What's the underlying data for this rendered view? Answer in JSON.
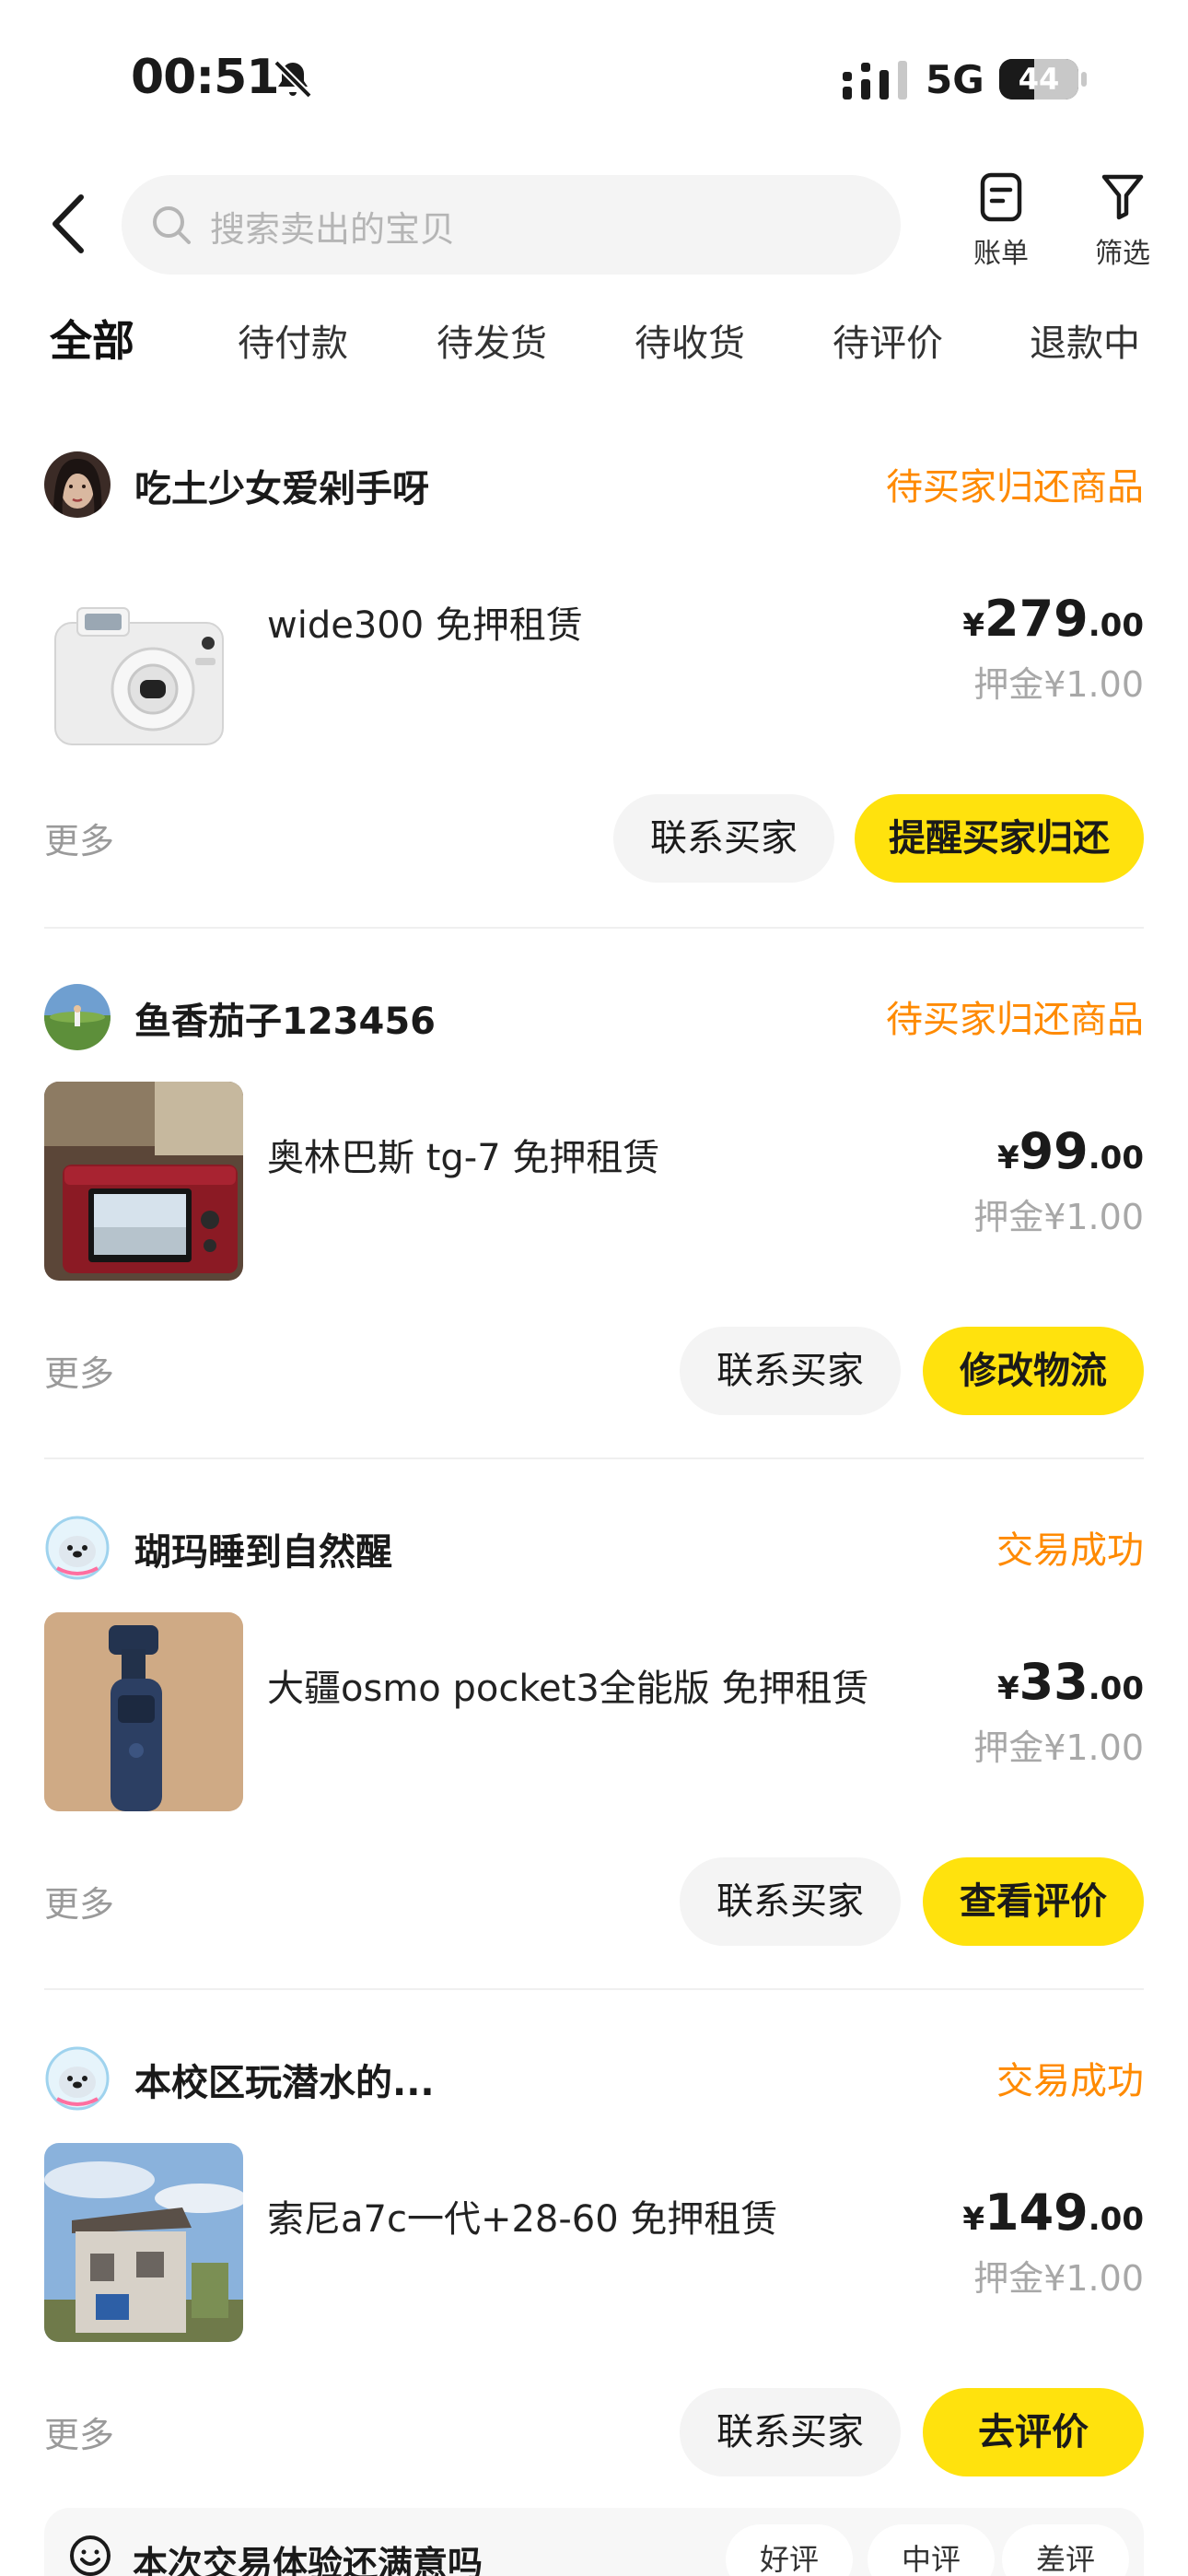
{
  "status_bar": {
    "time": "00:51",
    "network": "5G",
    "battery": "44",
    "battery_level": 0.44
  },
  "search": {
    "placeholder": "搜索卖出的宝贝"
  },
  "actions": {
    "bill": "账单",
    "filter": "筛选"
  },
  "tabs": [
    "全部",
    "待付款",
    "待发货",
    "待收货",
    "待评价",
    "退款中"
  ],
  "orders": [
    {
      "buyer": "吃土少女爱剁手呀",
      "status": "待买家归还商品",
      "title": "wide300 免押租赁",
      "currency": "¥",
      "price_int": "279",
      "price_dec": ".00",
      "deposit": "押金¥1.00",
      "more": "更多",
      "btn1": "联系买家",
      "btn2": "提醒买家归还"
    },
    {
      "buyer": "鱼香茄子123456",
      "status": "待买家归还商品",
      "title": "奥林巴斯 tg-7 免押租赁",
      "currency": "¥",
      "price_int": "99",
      "price_dec": ".00",
      "deposit": "押金¥1.00",
      "more": "更多",
      "btn1": "联系买家",
      "btn2": "修改物流"
    },
    {
      "buyer": "瑚玛睡到自然醒",
      "status": "交易成功",
      "title": "大疆osmo pocket3全能版 免押租赁",
      "currency": "¥",
      "price_int": "33",
      "price_dec": ".00",
      "deposit": "押金¥1.00",
      "more": "更多",
      "btn1": "联系买家",
      "btn2": "查看评价"
    },
    {
      "buyer": "本校区玩潜水的...",
      "status": "交易成功",
      "title": "索尼a7c一代+28-60 免押租赁",
      "currency": "¥",
      "price_int": "149",
      "price_dec": ".00",
      "deposit": "押金¥1.00",
      "more": "更多",
      "btn1": "联系买家",
      "btn2": "去评价"
    }
  ],
  "feedback": {
    "question": "本次交易体验还满意吗",
    "options": [
      "好评",
      "中评",
      "差评"
    ]
  }
}
